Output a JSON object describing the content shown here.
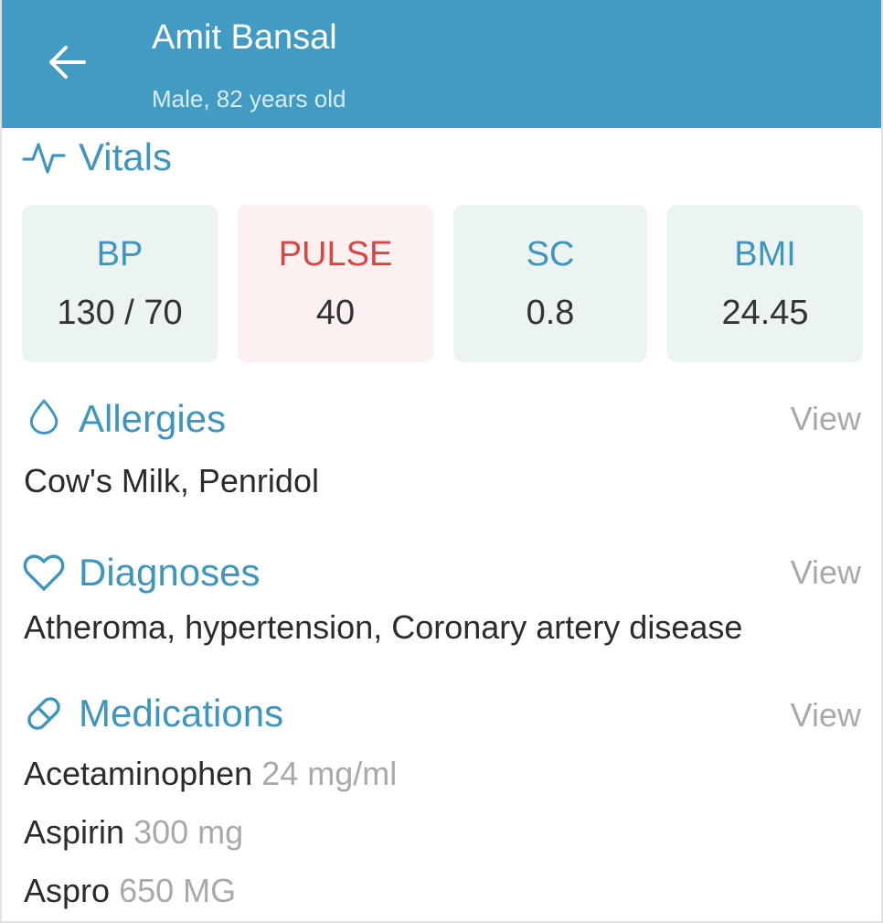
{
  "header": {
    "patient_name": "Amit Bansal",
    "patient_meta": "Male, 82 years old"
  },
  "vitals": {
    "title": "Vitals",
    "cards": [
      {
        "label": "BP",
        "value": "130 / 70",
        "status": "normal"
      },
      {
        "label": "PULSE",
        "value": "40",
        "status": "alert"
      },
      {
        "label": "SC",
        "value": "0.8",
        "status": "normal"
      },
      {
        "label": "BMI",
        "value": "24.45",
        "status": "normal"
      }
    ]
  },
  "allergies": {
    "title": "Allergies",
    "view_label": "View",
    "text": "Cow's Milk, Penridol"
  },
  "diagnoses": {
    "title": "Diagnoses",
    "view_label": "View",
    "text": "Atheroma, hypertension, Coronary artery disease"
  },
  "medications": {
    "title": "Medications",
    "view_label": "View",
    "items": [
      {
        "name": "Acetaminophen",
        "dose": "24 mg/ml"
      },
      {
        "name": "Aspirin",
        "dose": "300 mg"
      },
      {
        "name": "Aspro",
        "dose": "650 MG"
      }
    ]
  },
  "colors": {
    "header_bg": "#419bc2",
    "accent": "#3f95be",
    "alert": "#d84545",
    "card_bg": "#ebf4f1",
    "alert_card_bg": "#fcf0f0",
    "muted": "#a9a9a9"
  },
  "icons": {
    "back": "arrow-left-icon",
    "vitals": "pulse-icon",
    "allergies": "droplet-icon",
    "diagnoses": "heart-icon",
    "medications": "pill-icon"
  }
}
